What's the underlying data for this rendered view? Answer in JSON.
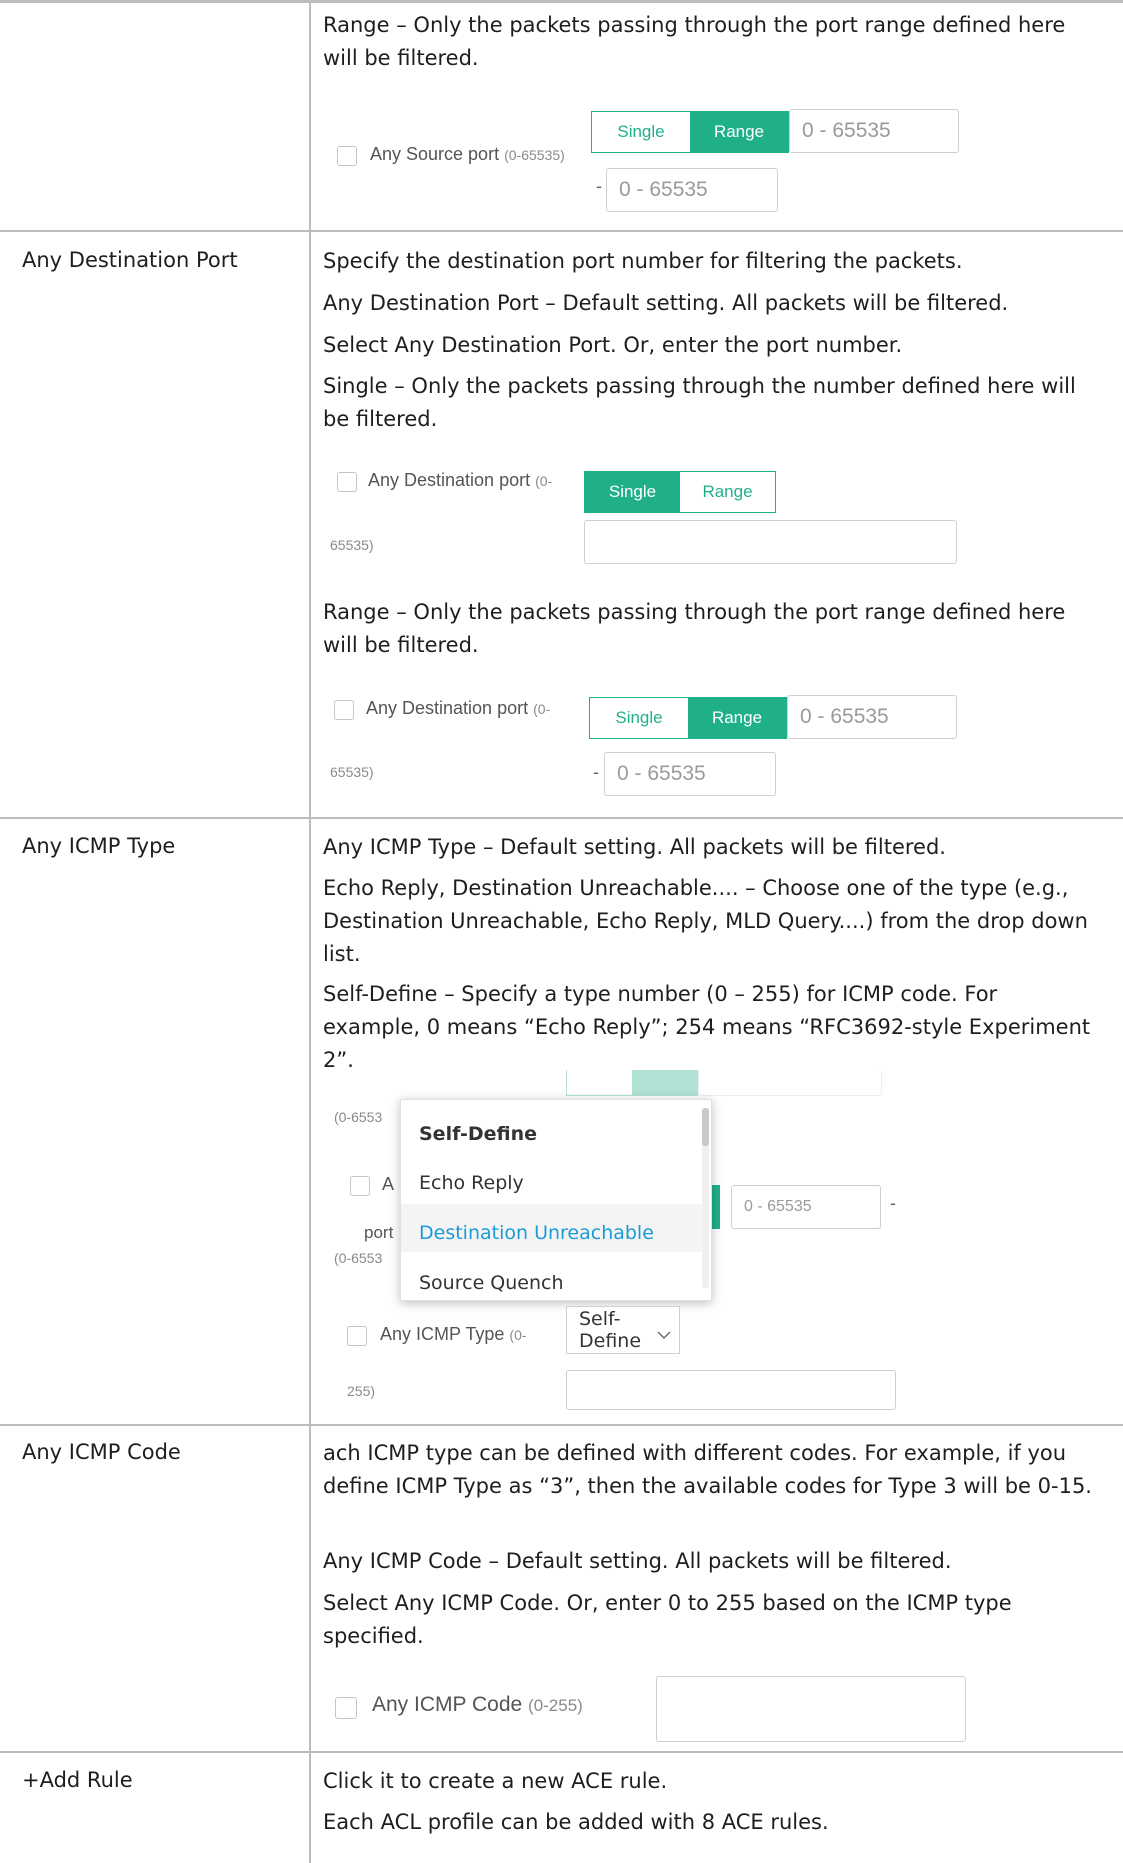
{
  "range_top": {
    "text": "Range – Only the packets passing through the port range defined here will be filtered.",
    "checkbox_label": "Any Source port",
    "checkbox_hint": "(0-65535)",
    "seg_single": "Single",
    "seg_range": "Range",
    "from_placeholder": "0 - 65535",
    "dash": "-",
    "to_placeholder": "0 - 65535"
  },
  "dest_port": {
    "label": "Any Destination Port",
    "p1": "Specify the destination port number for filtering the packets.",
    "p2": "Any Destination Port – Default setting. All packets will be filtered.",
    "p3": "Select Any Destination Port. Or, enter the port number.",
    "p4": "Single – Only the packets passing through the number defined here will be filtered.",
    "single_widget": {
      "checkbox_label": "Any Destination port",
      "hint1": "(0-",
      "hint2": "65535)",
      "seg_single": "Single",
      "seg_range": "Range"
    },
    "p5": "Range – Only the packets passing through the port range defined here will be filtered.",
    "range_widget": {
      "checkbox_label": "Any Destination port",
      "hint1": "(0-",
      "hint2": "65535)",
      "seg_single": "Single",
      "seg_range": "Range",
      "from_placeholder": "0 - 65535",
      "dash": "-",
      "to_placeholder": "0 - 65535"
    }
  },
  "icmp_type": {
    "label": "Any ICMP Type",
    "p1": "Any ICMP Type – Default setting. All packets will be filtered.",
    "p2": "Echo Reply, Destination Unreachable.... – Choose one of the type (e.g., Destination Unreachable, Echo Reply, MLD Query....) from the drop down list.",
    "p3": "Self-Define – Specify a type number (0 – 255) for ICMP code. For example, 0 means “Echo Reply”; 254 means “RFC3692-style Experiment 2”.",
    "widget": {
      "bg_hint1": "(0-6553",
      "bg_hint2": "(0-6553",
      "bg_port": "port",
      "bg_an": "A",
      "bg_input": "0 - 65535",
      "bg_dash": "-",
      "dropdown_items": [
        "Self-Define",
        "Echo Reply",
        "Destination Unreachable",
        "Source Quench"
      ],
      "checkbox_label": "Any ICMP Type",
      "hint1": "(0-",
      "hint2": "255)",
      "select_value": "Self-Define"
    }
  },
  "icmp_code": {
    "label": "Any ICMP Code",
    "p1": "ach ICMP type can be defined with different codes. For example, if you define ICMP Type as “3”, then the available codes for Type 3 will be 0-15.",
    "p2": "Any ICMP Code – Default setting. All packets will be filtered.",
    "p3": "Select Any ICMP Code. Or, enter 0 to 255 based on the ICMP type specified.",
    "widget": {
      "checkbox_label": "Any ICMP Code",
      "hint": "(0-255)"
    }
  },
  "add_rule": {
    "label": "+Add Rule",
    "p1": "Click it to create a new ACE rule.",
    "p2": "Each ACL profile can be added with 8 ACE rules."
  },
  "colors": {
    "accent": "#1fb08a",
    "link_blue": "#1a9bd7",
    "border": "#bdbdbd"
  }
}
